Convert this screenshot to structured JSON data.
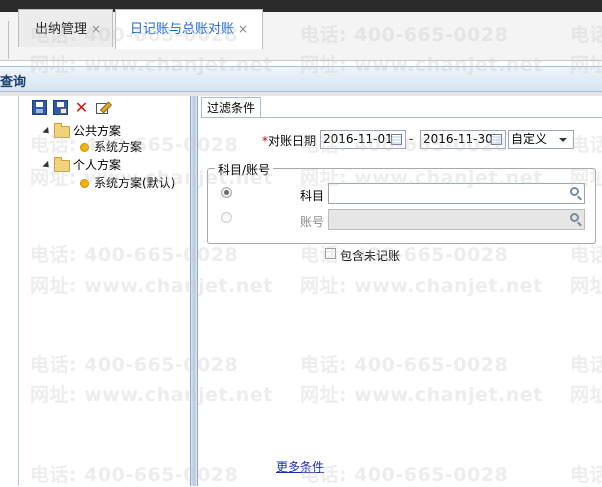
{
  "tabs": [
    {
      "label": "出纳管理",
      "close": "×"
    },
    {
      "label": "日记账与总账对账",
      "close": "×",
      "active": true
    }
  ],
  "title_bar": {
    "text": "查询"
  },
  "toolbar": {
    "icons": [
      "save-icon",
      "save-as-icon",
      "delete-icon",
      "edit-icon"
    ],
    "delete_glyph": "✕"
  },
  "tree": {
    "groups": [
      {
        "label": "公共方案",
        "items": [
          "系统方案"
        ]
      },
      {
        "label": "个人方案",
        "items": [
          "系统方案(默认)"
        ]
      }
    ]
  },
  "filter": {
    "tab_label": "过滤条件",
    "date_label": "对账日期",
    "required_mark": "*",
    "date_from": "2016-11-01",
    "date_sep": "-",
    "date_to": "2016-11-30",
    "period_select": "自定义",
    "group_legend": "科目/账号",
    "subject_label": "科目",
    "account_label": "账号",
    "include_unposted_label": "包含未记账",
    "more_conditions": "更多条件"
  },
  "watermark": {
    "phone": "电话: 400-665-0028",
    "site": "网址: www.chanjet.net",
    "phone_short": "电话",
    "site_short": "网址"
  },
  "colors": {
    "accent": "#1c66c8",
    "link": "#1a2fb0",
    "required": "#d40000"
  }
}
